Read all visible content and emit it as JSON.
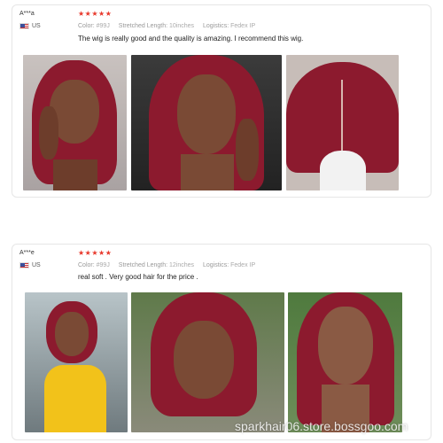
{
  "reviews": [
    {
      "user": "A***a",
      "country": "US",
      "rating": "★★★★★",
      "color_label": "Color:",
      "color_value": "#99J",
      "length_label": "Stretched Length:",
      "length_value": "10inches",
      "logistics_label": "Logistics:",
      "logistics_value": "Fedex IP",
      "text": "The wig is really good and the quality is amazing. I recommend this wig."
    },
    {
      "user": "A***e",
      "country": "US",
      "rating": "★★★★★",
      "color_label": "Color:",
      "color_value": "#99J",
      "length_label": "Stretched Length:",
      "length_value": "12inches",
      "logistics_label": "Logistics:",
      "logistics_value": "Fedex IP",
      "text": "real soft . Very good hair for the price ."
    }
  ],
  "watermark": "sparkhair06.store.bossgoo.com",
  "colors": {
    "star": "#e8382b",
    "hair": "#8c1a2e"
  }
}
